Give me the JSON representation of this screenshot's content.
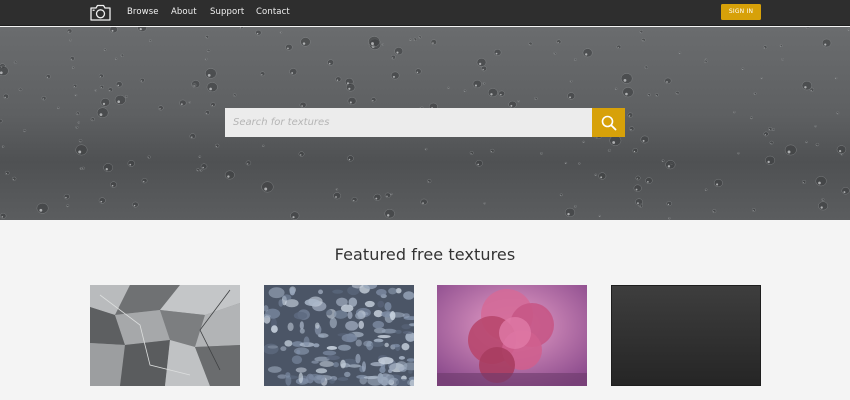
{
  "nav": {
    "logo_icon": "camera-icon",
    "links": [
      "Browse",
      "About",
      "Support",
      "Contact"
    ],
    "sign_in": "SIGN IN"
  },
  "hero": {
    "search_placeholder": "Search for textures",
    "search_icon": "search-icon"
  },
  "featured": {
    "title": "Featured free textures"
  },
  "colors": {
    "nav_background": "#2e2e2e",
    "accent": "#d7a109",
    "page_background": "#f4f4f4"
  }
}
